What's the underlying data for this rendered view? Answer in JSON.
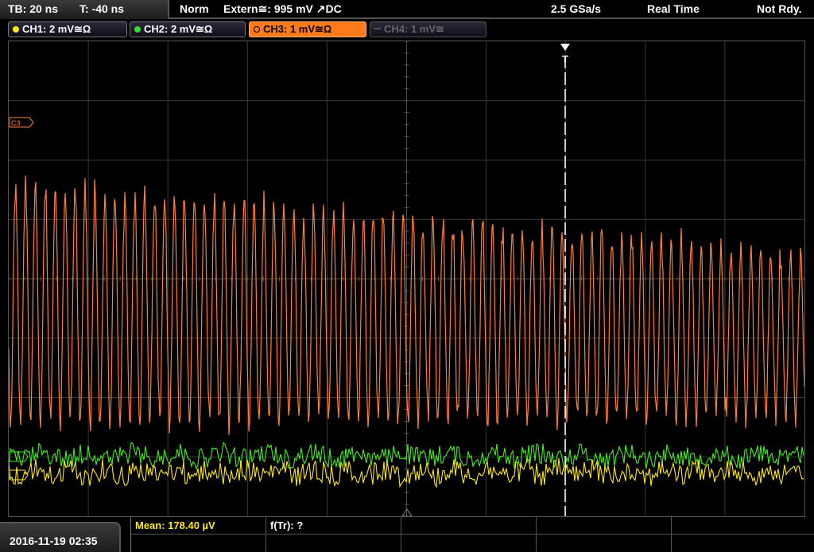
{
  "topbar": {
    "timebase": "TB: 20 ns",
    "trigger_time": "T: -40 ns",
    "mode": "Norm",
    "trigger": "Extern≅: 995 mV ↗DC",
    "sample_rate": "2.5 GSa/s",
    "acquisition": "Real Time",
    "status": "Not Rdy."
  },
  "channels": [
    {
      "label": "CH1: 2 mV≅Ω",
      "color": "#ffe81a",
      "state": "on"
    },
    {
      "label": "CH2: 2 mV≅Ω",
      "color": "#33dd33",
      "state": "on"
    },
    {
      "label": "CH3: 1 mV≅Ω",
      "color": "#ff7a1a",
      "state": "active"
    },
    {
      "label": "CH4: 1 mV≅",
      "color": "#555555",
      "state": "off"
    }
  ],
  "scope": {
    "ch3_marker": "C3",
    "trigger_marker": "T",
    "colors": {
      "ch1": "#ffe81a",
      "ch2": "#44ee22",
      "ch3": "#ff7f3a",
      "grid": "#3a3a3a"
    }
  },
  "bottom": {
    "datetime": "2016-11-19 02:35",
    "measurements": [
      {
        "label": "Mean: 178.40 µV",
        "color": "#ffe81a"
      },
      {
        "label": "f(Tr): ?",
        "color": "#ffffff"
      }
    ]
  }
}
